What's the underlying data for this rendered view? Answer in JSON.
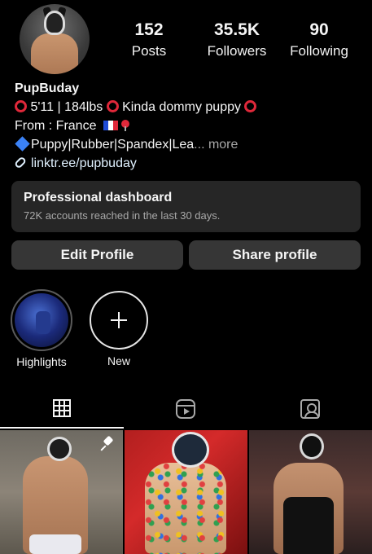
{
  "profile": {
    "username": "PupBuday",
    "stats": [
      {
        "value": "152",
        "label": "Posts"
      },
      {
        "value": "35.5K",
        "label": "Followers"
      },
      {
        "value": "90",
        "label": "Following"
      }
    ],
    "bio_line1": "5'11 | 184lbs",
    "bio_line1b": "Kinda dommy puppy",
    "bio_line2": "From : France",
    "bio_line3": "Puppy|Rubber|Spandex|Lea",
    "bio_more": "... more",
    "link": "linktr.ee/pupbuday"
  },
  "dashboard": {
    "title": "Professional dashboard",
    "subtitle": "72K accounts reached in the last 30 days."
  },
  "buttons": {
    "edit": "Edit Profile",
    "share": "Share profile"
  },
  "highlights": [
    {
      "label": "Highlights"
    },
    {
      "label": "New"
    }
  ],
  "tabs": {
    "icons": [
      "grid-icon",
      "reels-icon",
      "tagged-icon"
    ],
    "active": "grid-icon"
  },
  "colors": {
    "background": "#000000",
    "card": "#262626",
    "button": "#363636",
    "ring_red": "#e0283a",
    "muted": "#a8a8a8"
  }
}
